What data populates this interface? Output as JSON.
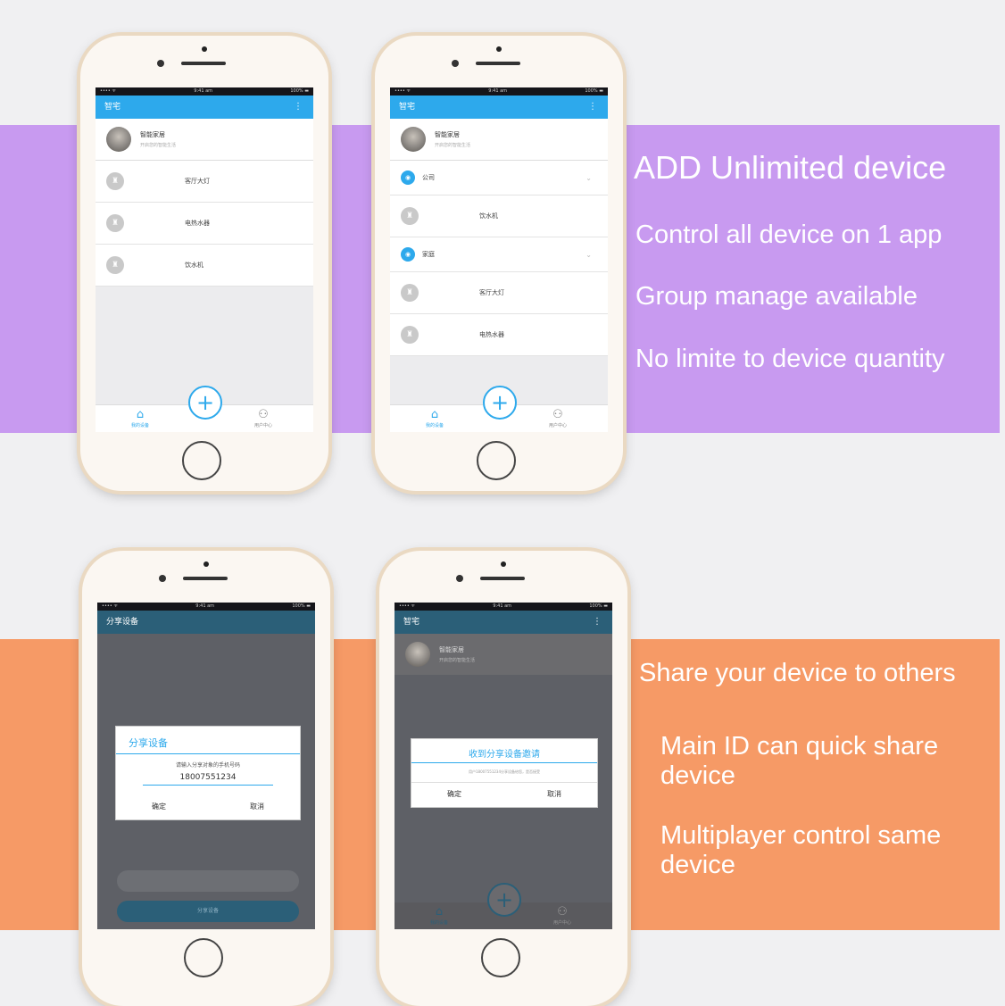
{
  "bands": {
    "top": {
      "headline": "ADD  Unlimited device",
      "line1": "Control all device on 1 app",
      "line2": "Group manage available",
      "line3": "No limite to device quantity"
    },
    "bottom": {
      "headline": "Share your device to others",
      "line1": "Main ID can quick share device",
      "line2": "Multiplayer control same device"
    }
  },
  "colors": {
    "accent": "#2da9ec",
    "purple_band": "#c89af0",
    "orange_band": "#f69a66"
  },
  "phone1": {
    "status": {
      "left": "•••• ᯤ",
      "center": "9:41 am",
      "right": "100% ▬"
    },
    "app_title": "智宅",
    "profile": {
      "name": "智能家居",
      "subtitle": "开启您的智能生活"
    },
    "devices": [
      {
        "icon": "device-icon",
        "name": "客厅大灯"
      },
      {
        "icon": "device-icon",
        "name": "电热水器"
      },
      {
        "icon": "device-icon",
        "name": "饮水机"
      }
    ],
    "tabs": {
      "home": "我的设备",
      "user": "用户中心"
    },
    "fab": "+"
  },
  "phone2": {
    "status": {
      "left": "•••• ᯤ",
      "center": "9:41 am",
      "right": "100% ▬"
    },
    "app_title": "智宅",
    "profile": {
      "name": "智能家居",
      "subtitle": "开启您的智能生活"
    },
    "groups": [
      {
        "name": "公司",
        "devices": [
          "饮水机"
        ]
      },
      {
        "name": "家庭",
        "devices": [
          "客厅大灯",
          "电热水器"
        ]
      }
    ],
    "tabs": {
      "home": "我的设备",
      "user": "用户中心"
    },
    "fab": "+"
  },
  "phone3": {
    "status": {
      "left": "•••• ᯤ",
      "center": "9:41 am",
      "right": "100% ▬"
    },
    "app_title": "分享设备",
    "dialog": {
      "title": "分享设备",
      "hint": "请输入分享对象的手机号码",
      "phone_number": "18007551234",
      "confirm": "确定",
      "cancel": "取消"
    },
    "share_button": "分享设备"
  },
  "phone4": {
    "status": {
      "left": "•••• ᯤ",
      "center": "9:41 am",
      "right": "100% ▬"
    },
    "app_title": "智宅",
    "profile": {
      "name": "智能家居",
      "subtitle": "开启您的智能生活"
    },
    "dialog": {
      "title": "收到分享设备邀请",
      "message": "用户18007551234分享设备给您，是否接受",
      "confirm": "确定",
      "cancel": "取消"
    },
    "tabs": {
      "home": "我的设备",
      "user": "用户中心"
    },
    "fab": "+"
  }
}
